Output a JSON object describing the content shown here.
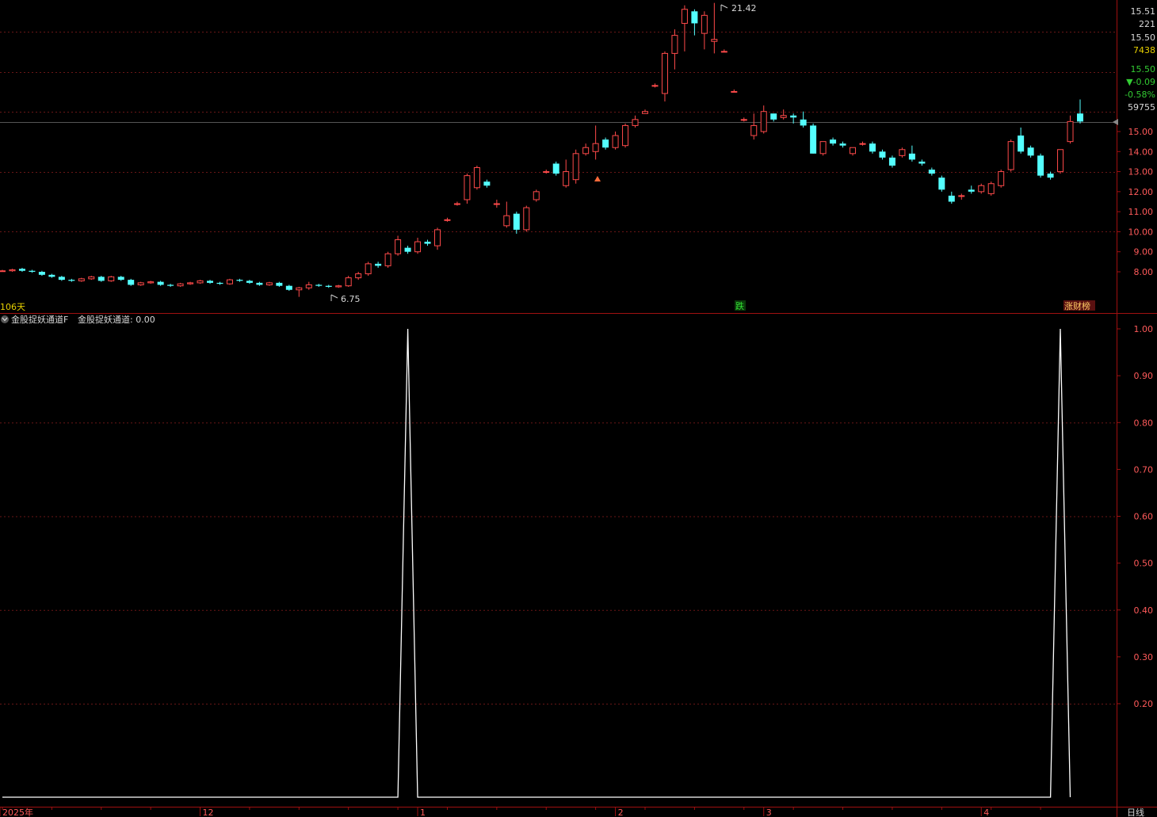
{
  "colors": {
    "up": "#ff4a4a",
    "down": "#54ffff",
    "axis_border": "#a01010",
    "grid": "#6a1616",
    "text_axis": "#ff5a5a",
    "text_info": "#d8d8d8",
    "flag_yellow": "#e7d000",
    "green": "#33cc33",
    "indicator_line": "#ffffff"
  },
  "header": {
    "days_label": "106天",
    "fall_badge": "跌",
    "up_badge": "涨财榜"
  },
  "info_panel": {
    "v1": "15.51",
    "v2": "221",
    "v3": "15.50",
    "v4": "7438",
    "v5": "15.50",
    "v6": "▼-0.09",
    "v7": "-0.58%",
    "v8": "59755"
  },
  "indicator": {
    "name": "金股捉妖通道F",
    "value_label": "金股捉妖通道: 0.00"
  },
  "annotations": {
    "high_label": "21.42",
    "low_label": "6.75"
  },
  "footer": {
    "period_label": "日线"
  },
  "chart_data": [
    {
      "type": "candlestick",
      "y_tick_labels": [
        "15.00",
        "14.00",
        "13.00",
        "12.00",
        "11.00",
        "10.00",
        "9.00",
        "8.00"
      ],
      "y_ticks": [
        15,
        14,
        13,
        12,
        11,
        10,
        9,
        8
      ],
      "x_tick_labels": [
        "2025年",
        "12",
        "1",
        "2",
        "3",
        "4"
      ],
      "x_tick_index": [
        0,
        20,
        42,
        62,
        77,
        99
      ],
      "high": 21.42,
      "low": 6.75,
      "candles": [
        [
          8.05,
          8.05,
          8.1,
          8.0
        ],
        [
          8.05,
          8.1,
          8.15,
          8.0
        ],
        [
          8.15,
          8.05,
          8.2,
          8.0
        ],
        [
          8.05,
          8.0,
          8.1,
          7.95
        ],
        [
          8.0,
          7.85,
          8.05,
          7.8
        ],
        [
          7.85,
          7.75,
          7.9,
          7.7
        ],
        [
          7.75,
          7.6,
          7.8,
          7.55
        ],
        [
          7.6,
          7.55,
          7.65,
          7.5
        ],
        [
          7.55,
          7.65,
          7.7,
          7.5
        ],
        [
          7.65,
          7.75,
          7.8,
          7.6
        ],
        [
          7.75,
          7.55,
          7.8,
          7.5
        ],
        [
          7.55,
          7.75,
          7.8,
          7.5
        ],
        [
          7.75,
          7.6,
          7.8,
          7.55
        ],
        [
          7.6,
          7.35,
          7.65,
          7.3
        ],
        [
          7.35,
          7.45,
          7.5,
          7.3
        ],
        [
          7.45,
          7.5,
          7.55,
          7.4
        ],
        [
          7.5,
          7.35,
          7.55,
          7.3
        ],
        [
          7.35,
          7.3,
          7.4,
          7.25
        ],
        [
          7.3,
          7.4,
          7.45,
          7.25
        ],
        [
          7.4,
          7.45,
          7.5,
          7.35
        ],
        [
          7.45,
          7.55,
          7.6,
          7.4
        ],
        [
          7.55,
          7.45,
          7.6,
          7.4
        ],
        [
          7.45,
          7.4,
          7.5,
          7.35
        ],
        [
          7.4,
          7.6,
          7.65,
          7.35
        ],
        [
          7.6,
          7.55,
          7.65,
          7.5
        ],
        [
          7.55,
          7.45,
          7.6,
          7.4
        ],
        [
          7.45,
          7.35,
          7.5,
          7.3
        ],
        [
          7.35,
          7.45,
          7.5,
          7.3
        ],
        [
          7.45,
          7.3,
          7.5,
          7.25
        ],
        [
          7.3,
          7.1,
          7.35,
          7.05
        ],
        [
          7.1,
          7.2,
          7.25,
          6.75
        ],
        [
          7.2,
          7.35,
          7.5,
          7.1
        ],
        [
          7.35,
          7.3,
          7.4,
          7.25
        ],
        [
          7.3,
          7.25,
          7.35,
          7.2
        ],
        [
          7.25,
          7.3,
          7.35,
          7.2
        ],
        [
          7.3,
          7.7,
          7.8,
          7.25
        ],
        [
          7.7,
          7.9,
          8.0,
          7.6
        ],
        [
          7.9,
          8.4,
          8.5,
          7.8
        ],
        [
          8.4,
          8.3,
          8.5,
          8.2
        ],
        [
          8.3,
          8.9,
          9.0,
          8.2
        ],
        [
          8.9,
          9.6,
          9.8,
          8.8
        ],
        [
          9.2,
          9.0,
          9.3,
          8.9
        ],
        [
          9.0,
          9.5,
          9.7,
          8.9
        ],
        [
          9.5,
          9.4,
          9.6,
          9.3
        ],
        [
          9.3,
          10.1,
          10.2,
          9.1
        ],
        [
          10.6,
          10.6,
          10.7,
          10.5
        ],
        [
          11.4,
          11.4,
          11.5,
          11.3
        ],
        [
          11.6,
          12.8,
          12.9,
          11.4
        ],
        [
          12.2,
          13.2,
          13.3,
          12.1
        ],
        [
          12.5,
          12.3,
          12.6,
          12.2
        ],
        [
          11.4,
          11.4,
          11.6,
          11.2
        ],
        [
          10.3,
          10.8,
          11.5,
          10.2
        ],
        [
          10.9,
          10.1,
          11.0,
          9.9
        ],
        [
          10.1,
          11.2,
          11.3,
          10.0
        ],
        [
          11.6,
          12.0,
          12.1,
          11.5
        ],
        [
          13.0,
          13.0,
          13.1,
          12.9
        ],
        [
          13.4,
          12.9,
          13.5,
          12.8
        ],
        [
          12.3,
          13.0,
          13.6,
          12.2
        ],
        [
          12.6,
          13.9,
          14.1,
          12.4
        ],
        [
          13.9,
          14.2,
          14.4,
          13.8
        ],
        [
          14.0,
          14.4,
          15.3,
          13.6
        ],
        [
          14.6,
          14.2,
          14.7,
          14.1
        ],
        [
          14.2,
          14.8,
          15.0,
          14.1
        ],
        [
          14.3,
          15.3,
          15.4,
          14.2
        ],
        [
          15.3,
          15.6,
          15.8,
          15.2
        ],
        [
          15.9,
          16.0,
          16.1,
          15.9
        ],
        [
          17.3,
          17.3,
          17.4,
          17.2
        ],
        [
          16.9,
          18.9,
          19.0,
          16.5
        ],
        [
          18.9,
          19.8,
          20.1,
          18.1
        ],
        [
          20.4,
          21.1,
          21.3,
          19.0
        ],
        [
          21.0,
          20.4,
          21.1,
          19.8
        ],
        [
          19.9,
          20.8,
          21.0,
          19.1
        ],
        [
          19.5,
          19.6,
          21.42,
          18.9
        ],
        [
          19.0,
          19.0,
          19.1,
          19.0
        ],
        [
          17.0,
          17.0,
          17.1,
          17.0
        ],
        [
          15.6,
          15.6,
          15.7,
          15.5
        ],
        [
          14.8,
          15.3,
          15.9,
          14.6
        ],
        [
          15.0,
          16.0,
          16.3,
          14.9
        ],
        [
          15.9,
          15.6,
          15.9,
          15.5
        ],
        [
          15.7,
          15.8,
          16.1,
          15.6
        ],
        [
          15.8,
          15.7,
          15.9,
          15.4
        ],
        [
          15.6,
          15.3,
          16.0,
          15.2
        ],
        [
          15.3,
          13.9,
          15.4,
          13.9
        ],
        [
          13.9,
          14.5,
          14.5,
          13.8
        ],
        [
          14.6,
          14.4,
          14.7,
          14.3
        ],
        [
          14.4,
          14.3,
          14.5,
          14.2
        ],
        [
          13.9,
          14.2,
          14.2,
          13.8
        ],
        [
          14.4,
          14.4,
          14.5,
          14.3
        ],
        [
          14.4,
          14.0,
          14.5,
          13.9
        ],
        [
          14.0,
          13.7,
          14.1,
          13.6
        ],
        [
          13.7,
          13.3,
          13.8,
          13.2
        ],
        [
          13.8,
          14.1,
          14.2,
          13.7
        ],
        [
          13.9,
          13.6,
          14.3,
          13.5
        ],
        [
          13.5,
          13.4,
          13.6,
          13.3
        ],
        [
          13.1,
          12.9,
          13.2,
          12.8
        ],
        [
          12.7,
          12.1,
          12.8,
          12.0
        ],
        [
          11.8,
          11.5,
          12.0,
          11.4
        ],
        [
          11.8,
          11.8,
          11.9,
          11.6
        ],
        [
          12.1,
          12.0,
          12.3,
          11.9
        ],
        [
          12.0,
          12.3,
          12.4,
          11.9
        ],
        [
          11.9,
          12.4,
          12.5,
          11.8
        ],
        [
          12.3,
          13.0,
          13.1,
          12.2
        ],
        [
          13.1,
          14.5,
          14.6,
          13.0
        ],
        [
          14.8,
          14.0,
          15.2,
          13.9
        ],
        [
          14.2,
          13.8,
          14.3,
          13.7
        ],
        [
          13.8,
          12.8,
          13.9,
          12.7
        ],
        [
          12.9,
          12.7,
          13.0,
          12.6
        ],
        [
          13.0,
          14.1,
          14.1,
          12.9
        ],
        [
          14.5,
          15.5,
          15.8,
          14.4
        ],
        [
          15.9,
          15.5,
          16.6,
          15.4
        ]
      ]
    },
    {
      "type": "line",
      "series": [
        {
          "values": [
            0,
            0,
            0,
            0,
            0,
            0,
            0,
            0,
            0,
            0,
            0,
            0,
            0,
            0,
            0,
            0,
            0,
            0,
            0,
            0,
            0,
            0,
            0,
            0,
            0,
            0,
            0,
            0,
            0,
            0,
            0,
            0,
            0,
            0,
            0,
            0,
            0,
            0,
            0,
            0,
            0,
            1,
            0,
            0,
            0,
            0,
            0,
            0,
            0,
            0,
            0,
            0,
            0,
            0,
            0,
            0,
            0,
            0,
            0,
            0,
            0,
            0,
            0,
            0,
            0,
            0,
            0,
            0,
            0,
            0,
            0,
            0,
            0,
            0,
            0,
            0,
            0,
            0,
            0,
            0,
            0,
            0,
            0,
            0,
            0,
            0,
            0,
            0,
            0,
            0,
            0,
            0,
            0,
            0,
            0,
            0,
            0,
            0,
            0,
            0,
            0,
            0,
            0,
            0,
            0,
            0,
            0,
            1,
            0
          ]
        }
      ],
      "y_tick_labels": [
        "1.00",
        "0.90",
        "0.80",
        "0.70",
        "0.60",
        "0.50",
        "0.40",
        "0.30",
        "0.20"
      ],
      "y_ticks": [
        1.0,
        0.9,
        0.8,
        0.7,
        0.6,
        0.5,
        0.4,
        0.3,
        0.2
      ],
      "ylim": [
        0,
        1
      ]
    }
  ]
}
